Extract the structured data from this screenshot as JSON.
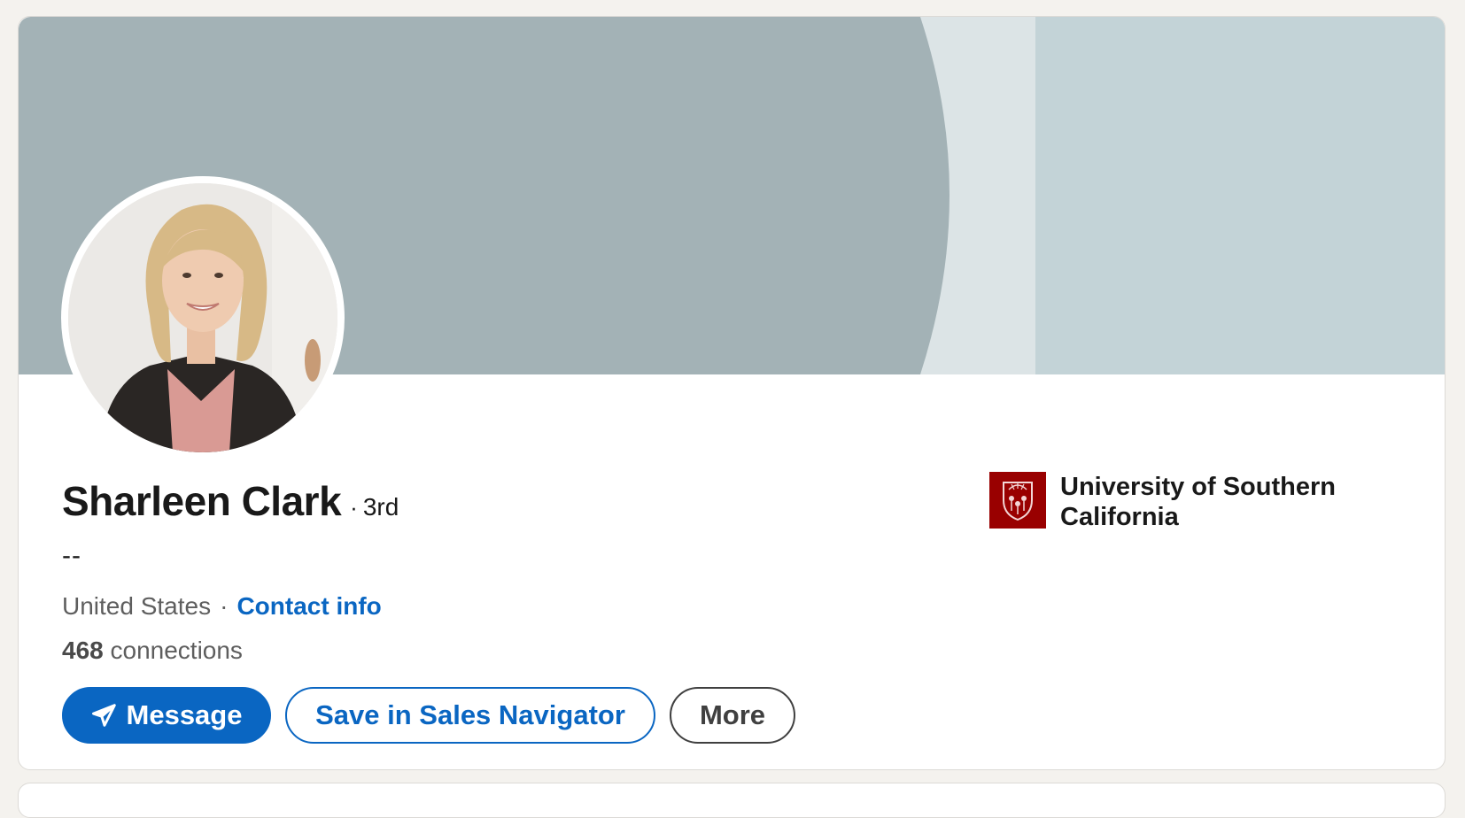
{
  "profile": {
    "name": "Sharleen Clark",
    "degree_separator": "·",
    "degree": "3rd",
    "headline": "--",
    "location": "United States",
    "meta_separator": "·",
    "contact_info_label": "Contact info",
    "connections_count": "468",
    "connections_label": "connections"
  },
  "actions": {
    "message_label": "Message",
    "save_sales_navigator_label": "Save in Sales Navigator",
    "more_label": "More"
  },
  "education": {
    "school_name": "University of Southern California",
    "logo_icon": "usc-seal-icon",
    "logo_color": "#990000"
  },
  "colors": {
    "accent": "#0a66c2",
    "banner_dark": "#a3b2b6",
    "banner_light": "#dce4e6",
    "banner_right": "#c3d3d7"
  }
}
